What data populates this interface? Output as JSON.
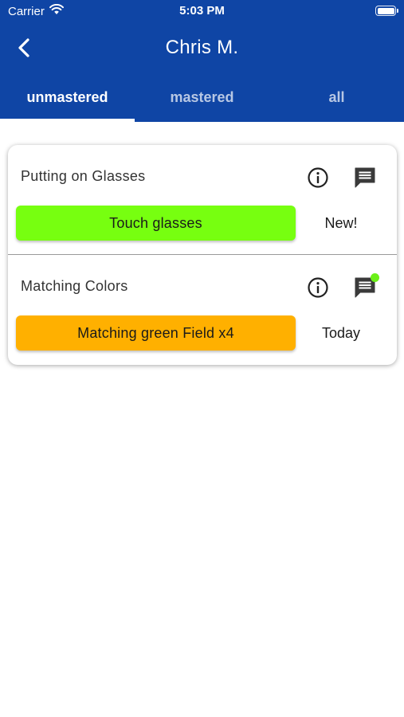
{
  "status_bar": {
    "carrier": "Carrier",
    "time": "5:03 PM"
  },
  "nav": {
    "title": "Chris M."
  },
  "tabs": [
    {
      "label": "unmastered",
      "active": true
    },
    {
      "label": "mastered",
      "active": false
    },
    {
      "label": "all",
      "active": false
    }
  ],
  "items": [
    {
      "title": "Putting on Glasses",
      "action_label": "Touch glasses",
      "action_color": "#77ff10",
      "status": "New!",
      "has_new_comment": false
    },
    {
      "title": "Matching Colors",
      "action_label": "Matching green Field x4",
      "action_color": "#ffb000",
      "status": "Today",
      "has_new_comment": true
    }
  ],
  "colors": {
    "header_bg": "#0f45a5",
    "notification_dot": "#6cf018"
  }
}
